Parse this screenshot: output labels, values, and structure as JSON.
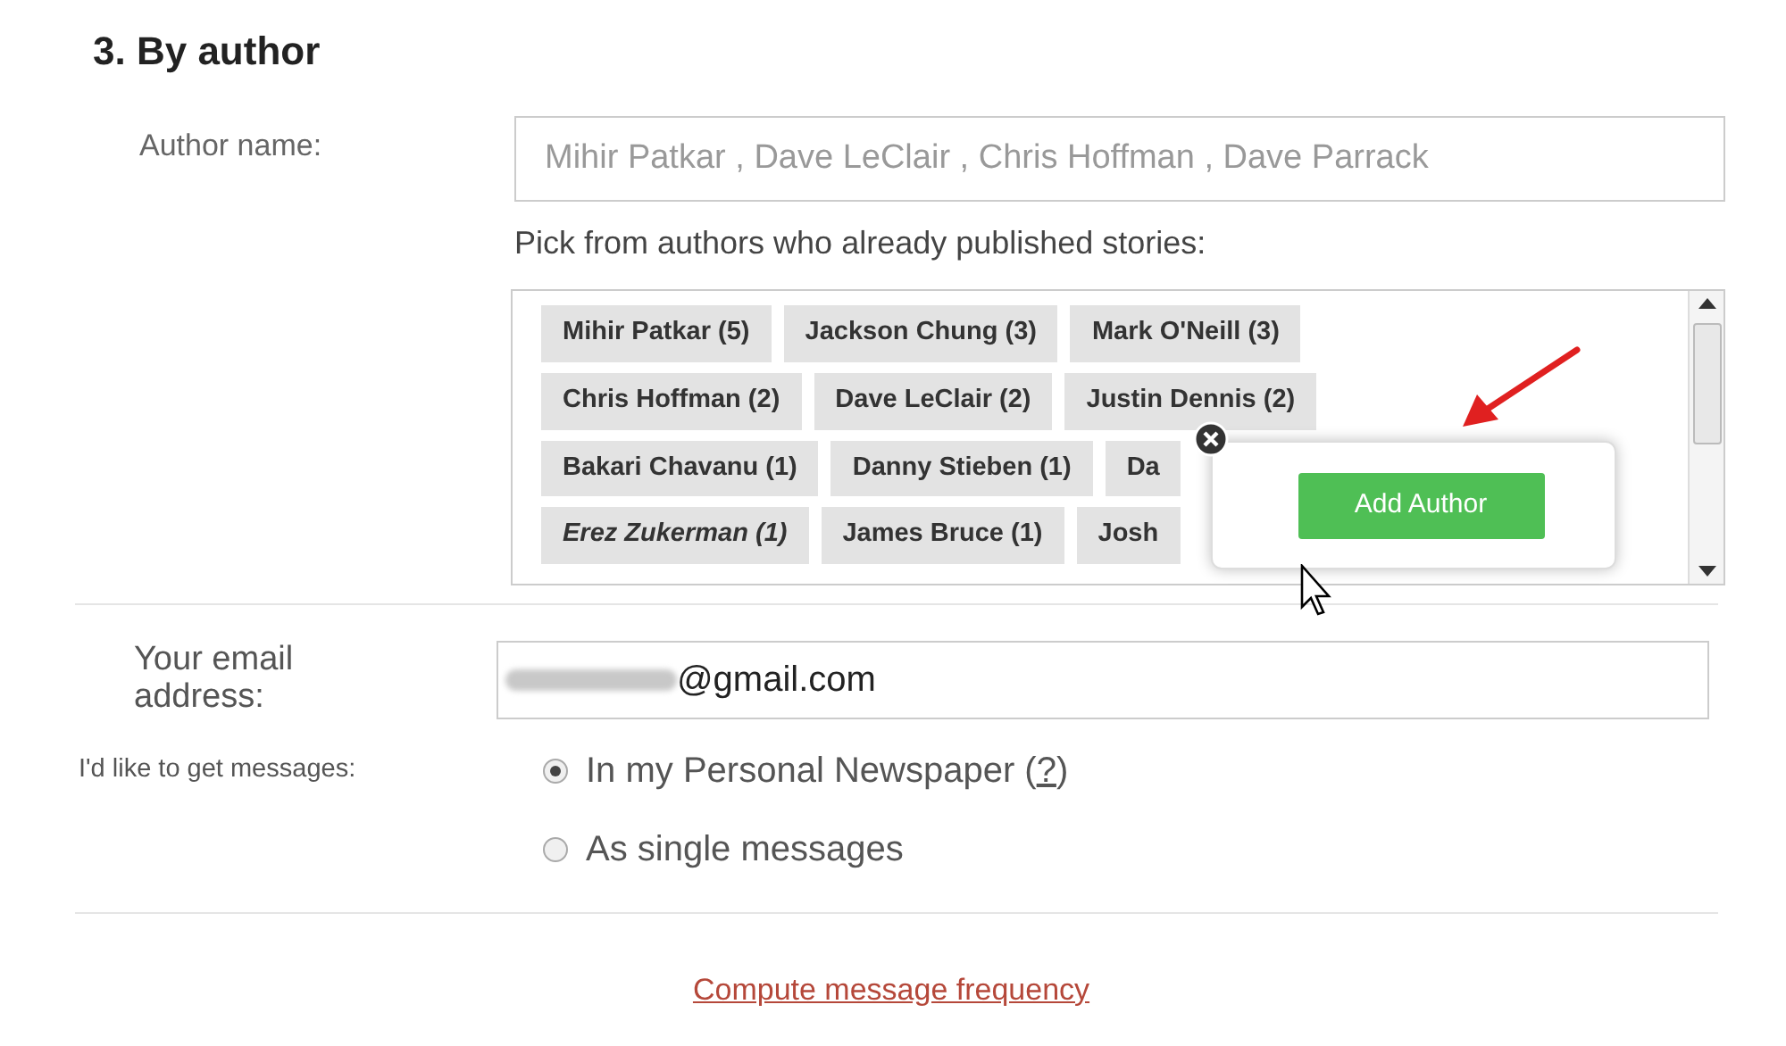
{
  "section_title": "3. By author",
  "author_name": {
    "label": "Author name:",
    "placeholder": "Mihir Patkar , Dave LeClair , Chris Hoffman , Dave Parrack"
  },
  "pick_hint": "Pick from authors who already published stories:",
  "author_rows": [
    [
      {
        "label": "Mihir Patkar (5)",
        "italic": false
      },
      {
        "label": "Jackson Chung (3)",
        "italic": false
      },
      {
        "label": "Mark O'Neill (3)",
        "italic": false
      }
    ],
    [
      {
        "label": "Chris Hoffman (2)",
        "italic": false
      },
      {
        "label": "Dave LeClair (2)",
        "italic": false
      },
      {
        "label": "Justin Dennis (2)",
        "italic": false
      }
    ],
    [
      {
        "label": "Bakari Chavanu (1)",
        "italic": false
      },
      {
        "label": "Danny Stieben (1)",
        "italic": false
      },
      {
        "label": "Da",
        "italic": false
      }
    ],
    [
      {
        "label": "Erez Zukerman (1)",
        "italic": true
      },
      {
        "label": "James Bruce (1)",
        "italic": false
      },
      {
        "label": "Josh",
        "italic": false
      }
    ]
  ],
  "popup": {
    "button": "Add Author"
  },
  "email": {
    "label": "Your email address:",
    "value": "@gmail.com"
  },
  "delivery": {
    "label": "I'd like to get messages:",
    "options": [
      {
        "label": "In my Personal Newspaper (",
        "help": "?",
        "after": ")",
        "selected": true
      },
      {
        "label": "As single messages",
        "selected": false
      }
    ]
  },
  "link": "Compute message frequency"
}
